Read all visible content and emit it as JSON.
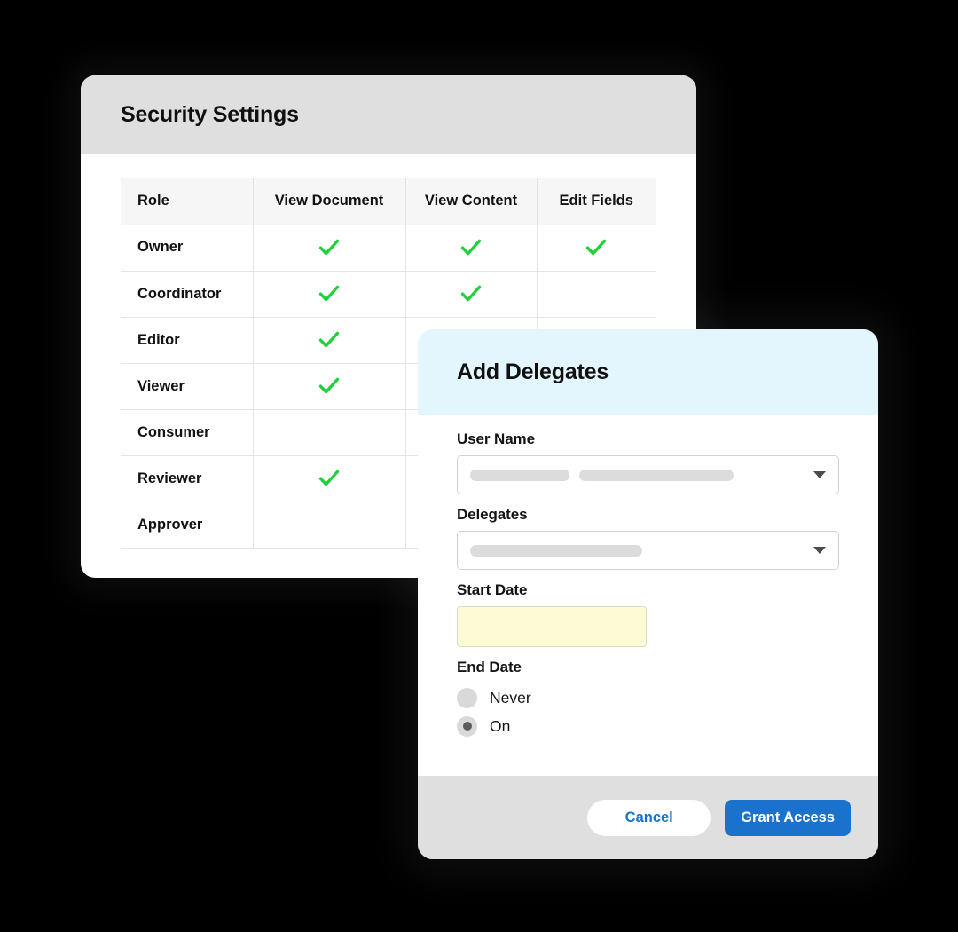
{
  "security_card": {
    "title": "Security Settings",
    "table": {
      "columns": [
        "Role",
        "View Document",
        "View Content",
        "Edit Fields"
      ],
      "check_icon": "check-icon",
      "check_color": "#22d03c",
      "rows": [
        {
          "role": "Owner",
          "view_document": true,
          "view_content": true,
          "edit_fields": true
        },
        {
          "role": "Coordinator",
          "view_document": true,
          "view_content": true,
          "edit_fields": false
        },
        {
          "role": "Editor",
          "view_document": true,
          "view_content": false,
          "edit_fields": false
        },
        {
          "role": "Viewer",
          "view_document": true,
          "view_content": false,
          "edit_fields": false
        },
        {
          "role": "Consumer",
          "view_document": false,
          "view_content": false,
          "edit_fields": false
        },
        {
          "role": "Reviewer",
          "view_document": true,
          "view_content": false,
          "edit_fields": false
        },
        {
          "role": "Approver",
          "view_document": false,
          "view_content": false,
          "edit_fields": false
        }
      ]
    }
  },
  "delegates_dialog": {
    "title": "Add Delegates",
    "header_color": "#e4f6fd",
    "fields": {
      "user_name": {
        "label": "User Name",
        "value": "",
        "placeholder": "",
        "arrow_icon": "chevron-down-icon"
      },
      "delegates": {
        "label": "Delegates",
        "value": "",
        "placeholder": "",
        "arrow_icon": "chevron-down-icon"
      },
      "start_date": {
        "label": "Start Date",
        "value": "",
        "placeholder": "",
        "highlight_color": "#fcfbd5"
      },
      "end_date": {
        "label": "End Date",
        "selected": "On",
        "options": [
          {
            "label": "Never",
            "selected": false
          },
          {
            "label": "On",
            "selected": true
          }
        ]
      }
    },
    "footer": {
      "cancel_label": "Cancel",
      "grant_label": "Grant Access",
      "accent_color": "#1b72cd"
    }
  }
}
